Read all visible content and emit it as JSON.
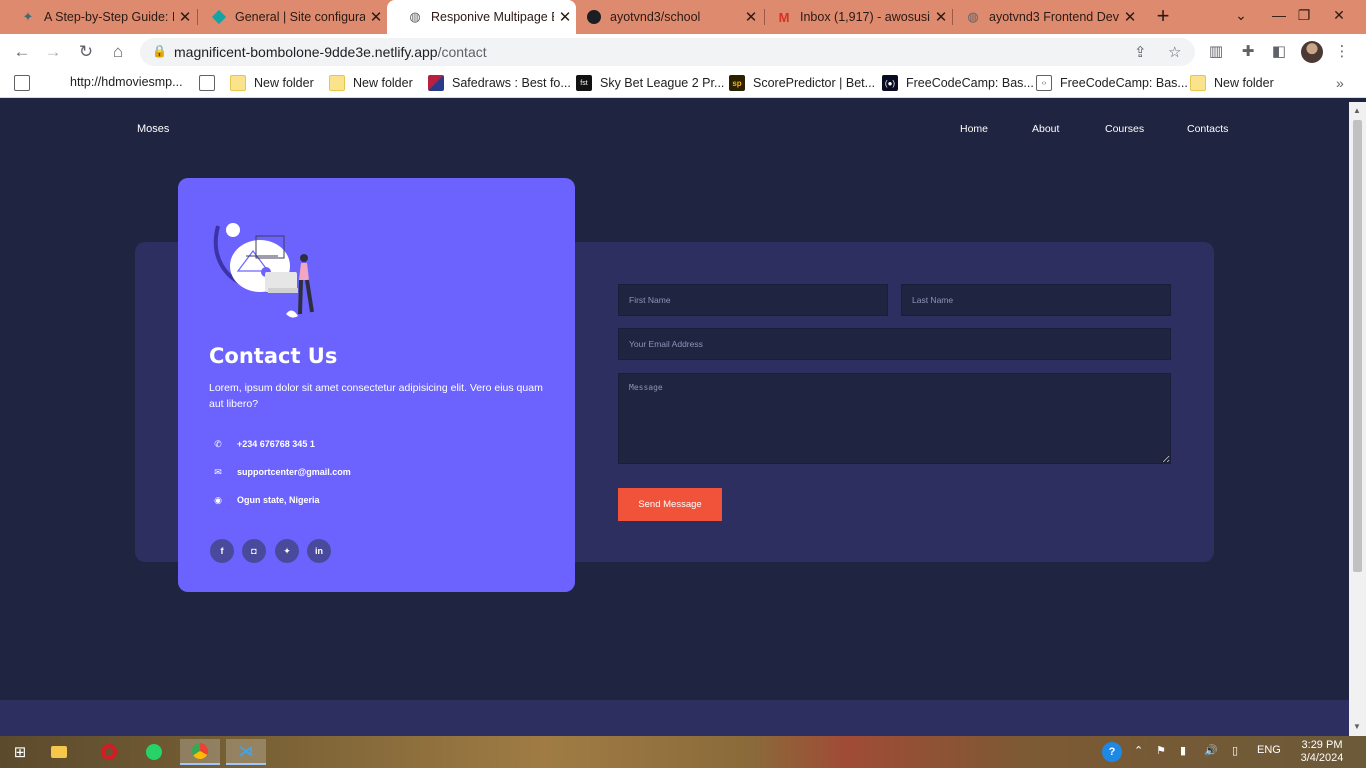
{
  "browser": {
    "tabs": [
      {
        "title": "A Step-by-Step Guide: I",
        "icon": "netlify-icon"
      },
      {
        "title": "General | Site configura",
        "icon": "netlify-diamond-icon"
      },
      {
        "title": "Responive Multipage Ec",
        "icon": "globe-icon",
        "active": true
      },
      {
        "title": "ayotvnd3/school",
        "icon": "github-icon"
      },
      {
        "title": "Inbox (1,917) - awosusi",
        "icon": "gmail-icon"
      },
      {
        "title": "ayotvnd3 Frontend Dev",
        "icon": "globe-icon"
      }
    ],
    "url_host": "magnificent-bombolone-9dde3e.netlify.app",
    "url_path": "/contact",
    "bookmarks": [
      {
        "label": "http://hdmoviesmp...",
        "icon": "globe-icon"
      },
      {
        "label": "",
        "icon": "globe-icon"
      },
      {
        "label": "New folder",
        "icon": "folder-icon"
      },
      {
        "label": "New folder",
        "icon": "folder-icon"
      },
      {
        "label": "Safedraws : Best fo...",
        "icon": "safedraws-icon"
      },
      {
        "label": "Sky Bet League 2 Pr...",
        "icon": "fst-icon"
      },
      {
        "label": "ScorePredictor | Bet...",
        "icon": "sp-icon"
      },
      {
        "label": "FreeCodeCamp: Bas...",
        "icon": "fcc-icon"
      },
      {
        "label": "FreeCodeCamp: Bas...",
        "icon": "code-icon"
      },
      {
        "label": "New folder",
        "icon": "folder-icon"
      }
    ]
  },
  "site": {
    "brand": "Moses",
    "nav": [
      "Home",
      "About",
      "Courses",
      "Contacts"
    ],
    "contact": {
      "title": "Contact Us",
      "description": "Lorem, ipsum dolor sit amet consectetur adipisicing elit. Vero eius quam aut libero?",
      "phone": "+234 676768 345 1",
      "email": "supportcenter@gmail.com",
      "location": "Ogun state, Nigeria",
      "socials": [
        "f",
        "ig",
        "tw",
        "in"
      ]
    },
    "form": {
      "first_name_placeholder": "First Name",
      "last_name_placeholder": "Last Name",
      "email_placeholder": "Your Email Address",
      "message_placeholder": "Message",
      "send_label": "Send Message"
    }
  },
  "taskbar": {
    "language": "ENG",
    "time": "3:29 PM",
    "date": "3/4/2024"
  }
}
